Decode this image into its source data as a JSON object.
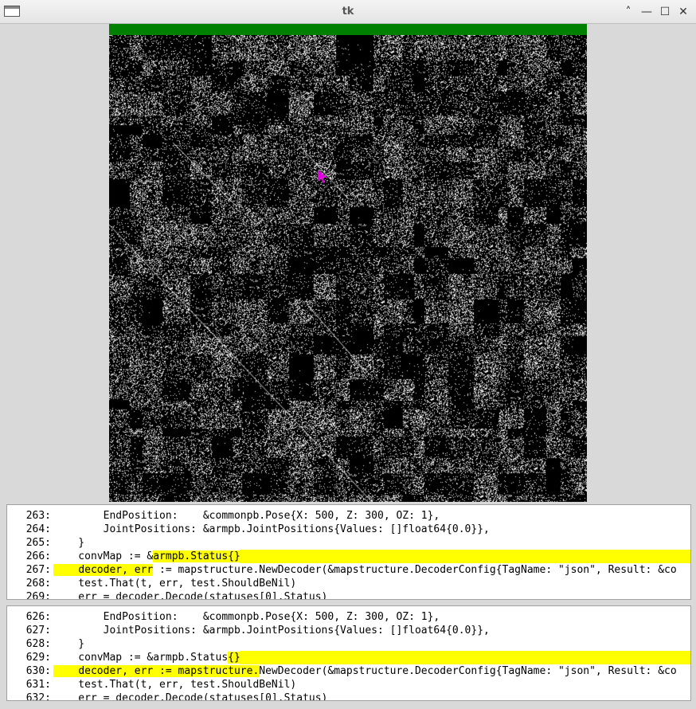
{
  "window": {
    "title": "tk",
    "controls": {
      "shade": "˄",
      "minimize": "—",
      "maximize": "☐",
      "close": "✕"
    }
  },
  "progress": {
    "value": 1.0,
    "color": "#008000"
  },
  "dotplot": {
    "background": "#000000",
    "dot_color": "#ffffff",
    "cursor_color": "#e000e0",
    "description_icon": "pointer-cursor-icon"
  },
  "panels": [
    {
      "lines": [
        {
          "num": "263:",
          "segments": [
            {
              "text": "        EndPosition:    &commonpb.Pose{X: 500, Z: 300, OZ: 1},",
              "hl": false
            }
          ]
        },
        {
          "num": "264:",
          "segments": [
            {
              "text": "        JointPositions: &armpb.JointPositions{Values: []float64{0.0}},",
              "hl": false
            }
          ]
        },
        {
          "num": "265:",
          "segments": [
            {
              "text": "    }",
              "hl": false
            }
          ]
        },
        {
          "num": "266:",
          "segments": [
            {
              "text": "    convMap := &",
              "hl": false
            },
            {
              "text": "armpb.Status{}",
              "hl": true
            }
          ],
          "tail_hl": true
        },
        {
          "num": "267:",
          "segments": [
            {
              "text": "    ",
              "hl": true
            },
            {
              "text": "decoder, err",
              "hl": true
            },
            {
              "text": " := mapstructure.NewDecoder(&mapstructure.DecoderConfig{TagName: \"json\", Result: &co",
              "hl": false
            }
          ],
          "lead_hl": true
        },
        {
          "num": "268:",
          "segments": [
            {
              "text": "    test.That(t, err, test.ShouldBeNil)",
              "hl": false
            }
          ]
        },
        {
          "num": "269:",
          "segments": [
            {
              "text": "    err = decoder.Decode(statuses[0].Status)",
              "hl": false
            }
          ]
        }
      ]
    },
    {
      "lines": [
        {
          "num": "626:",
          "segments": [
            {
              "text": "        EndPosition:    &commonpb.Pose{X: 500, Z: 300, OZ: 1},",
              "hl": false
            }
          ]
        },
        {
          "num": "627:",
          "segments": [
            {
              "text": "        JointPositions: &armpb.JointPositions{Values: []float64{0.0}},",
              "hl": false
            }
          ]
        },
        {
          "num": "628:",
          "segments": [
            {
              "text": "    }",
              "hl": false
            }
          ]
        },
        {
          "num": "629:",
          "segments": [
            {
              "text": "    convMap := &armpb.Status",
              "hl": false
            },
            {
              "text": "{}",
              "hl": true
            }
          ],
          "tail_hl": true
        },
        {
          "num": "630:",
          "segments": [
            {
              "text": "    ",
              "hl": true
            },
            {
              "text": "decoder, err := mapstructure.",
              "hl": true
            },
            {
              "text": "NewDecoder(&mapstructure.DecoderConfig{TagName: \"json\", Result: &co",
              "hl": false
            }
          ],
          "lead_hl": true
        },
        {
          "num": "631:",
          "segments": [
            {
              "text": "    test.That(t, err, test.ShouldBeNil)",
              "hl": false
            }
          ]
        },
        {
          "num": "632:",
          "segments": [
            {
              "text": "    err = decoder.Decode(statuses[0].Status)",
              "hl": false
            }
          ]
        }
      ]
    }
  ]
}
